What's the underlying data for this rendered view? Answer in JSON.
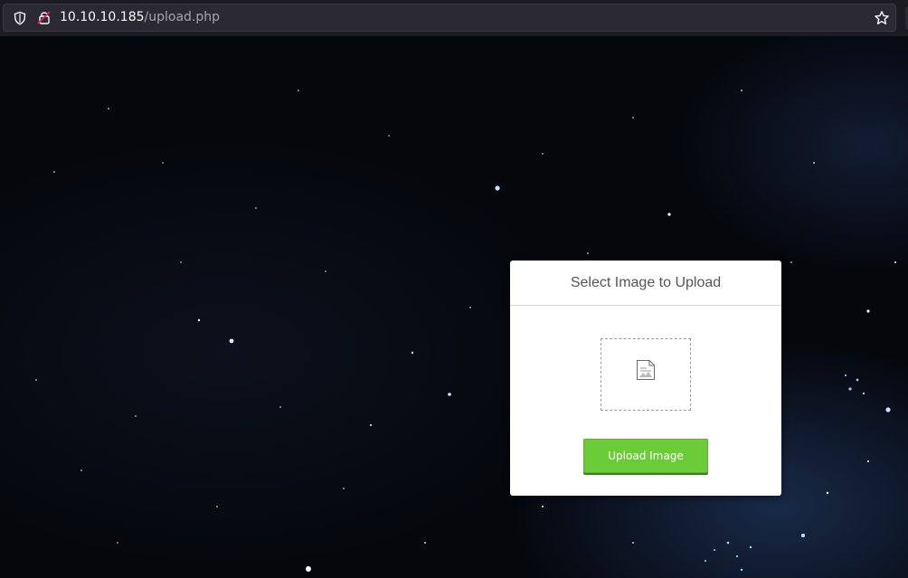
{
  "browser": {
    "url_host": "10.10.10.185",
    "url_path": "/upload.php",
    "icons": {
      "tracking": "shield-icon",
      "security": "lock-warning-icon",
      "bookmark": "star-icon"
    }
  },
  "upload_card": {
    "title": "Select Image to Upload",
    "preview_icon": "broken-image-icon",
    "button_label": "Upload Image"
  },
  "colors": {
    "button": "#6bcc38",
    "chrome": "#1c1b22",
    "urlbar": "#2b2a33",
    "background": "#05070d"
  }
}
